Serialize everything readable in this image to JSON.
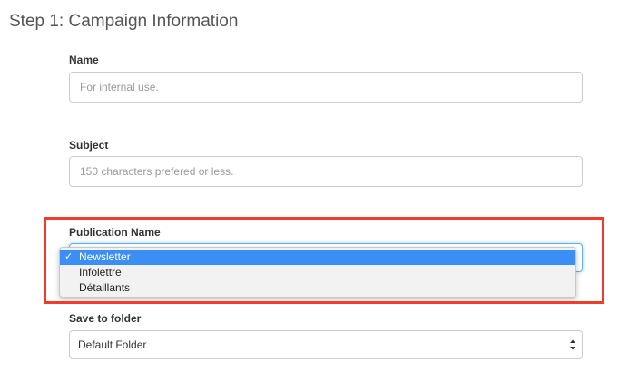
{
  "step_title": "Step 1: Campaign Information",
  "fields": {
    "name": {
      "label": "Name",
      "placeholder": "For internal use."
    },
    "subject": {
      "label": "Subject",
      "placeholder": "150 characters prefered or less."
    },
    "publication": {
      "label": "Publication Name",
      "options": [
        "Newsletter",
        "Infolettre",
        "Détaillants"
      ],
      "selected": "Newsletter",
      "dropdown_open": true
    },
    "folder": {
      "label": "Save to folder",
      "value": "Default Folder"
    }
  },
  "colors": {
    "highlight": "#f23b2a",
    "selected_option": "#3b8ef3",
    "focus_border": "#66afe9"
  },
  "icons": {
    "check": "✓",
    "select_arrows": "up-down-chevron-icon"
  }
}
